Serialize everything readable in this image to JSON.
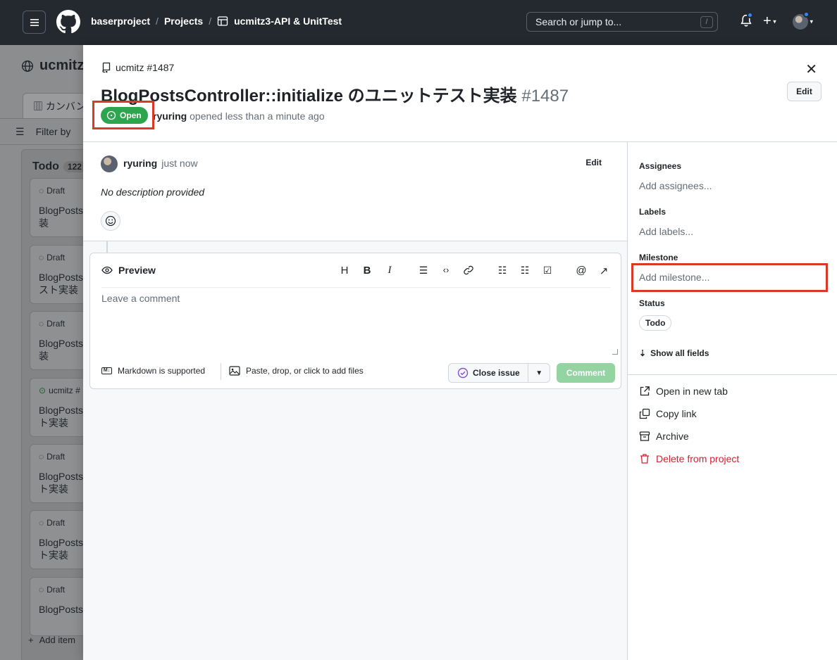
{
  "header": {
    "org": "baserproject",
    "projects": "Projects",
    "project_name": "ucmitz3-API & UnitTest",
    "search_placeholder": "Search or jump to...",
    "search_key": "/"
  },
  "board": {
    "title": "ucmitz",
    "view_tab": "カンバン",
    "filter": "Filter by",
    "column_title": "Todo",
    "column_count": "122",
    "cards": [
      {
        "meta": "Draft",
        "title": "BlogPosts\n装"
      },
      {
        "meta": "Draft",
        "title": "BlogPosts\nスト実装"
      },
      {
        "meta": "Draft",
        "title": "BlogPosts\n装"
      },
      {
        "meta": "ucmitz #",
        "title": "BlogPosts\nト実装"
      },
      {
        "meta": "Draft",
        "title": "BlogPosts\nト実装"
      },
      {
        "meta": "Draft",
        "title": "BlogPosts\nト実装"
      },
      {
        "meta": "Draft",
        "title": "BlogPosts"
      }
    ],
    "add_item": "Add item"
  },
  "issue": {
    "repo_ref": "ucmitz #1487",
    "title": "BlogPostsController::initialize のユニットテスト実装",
    "number": "#1487",
    "edit": "Edit",
    "state": "Open",
    "author": "ryuring",
    "opened_text": "opened less than a minute ago"
  },
  "comment": {
    "author": "ryuring",
    "time": "just now",
    "edit": "Edit",
    "body": "No description provided"
  },
  "editor": {
    "preview": "Preview",
    "placeholder": "Leave a comment",
    "markdown_note": "Markdown is supported",
    "files_note": "Paste, drop, or click to add files",
    "close_issue": "Close issue",
    "comment_button": "Comment",
    "tools": [
      "heading-icon",
      "bold-icon",
      "italic-icon",
      "quote-icon",
      "code-icon",
      "link-icon",
      "bulleted-list-icon",
      "numbered-list-icon",
      "task-list-icon",
      "mention-icon",
      "reference-icon"
    ]
  },
  "sidebar": {
    "assignees_label": "Assignees",
    "assignees_value": "Add assignees...",
    "labels_label": "Labels",
    "labels_value": "Add labels...",
    "milestone_label": "Milestone",
    "milestone_value": "Add milestone...",
    "status_label": "Status",
    "status_value": "Todo",
    "show_all": "Show all fields",
    "actions": {
      "open_new_tab": "Open in new tab",
      "copy_link": "Copy link",
      "archive": "Archive",
      "delete": "Delete from project"
    }
  },
  "colors": {
    "header_bg": "#24292f",
    "open_green": "#2da44e",
    "comment_disabled": "#94d3a2",
    "danger": "#cf222e",
    "highlight": "#d93a26"
  }
}
